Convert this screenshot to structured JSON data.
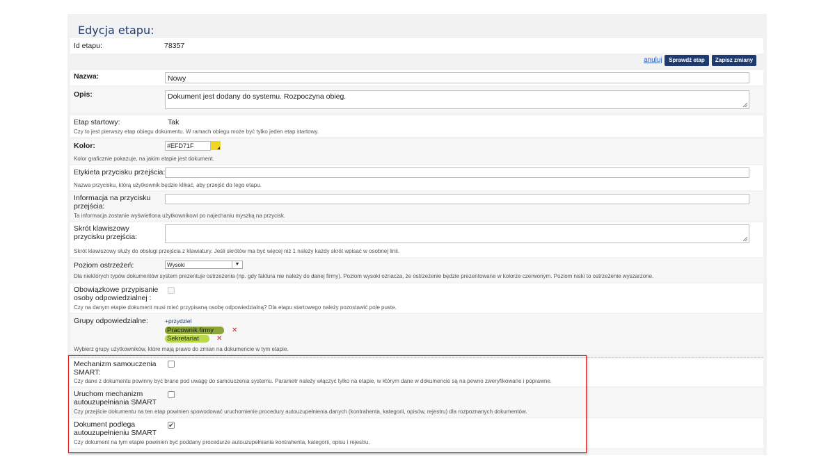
{
  "title": "Edycja etapu:",
  "id_label": "Id etapu:",
  "id_value": "78357",
  "actions": {
    "cancel": "anuluj",
    "check": "Sprawdź etap",
    "save": "Zapisz zmiany"
  },
  "name": {
    "label": "Nazwa:",
    "value": "Nowy"
  },
  "desc": {
    "label": "Opis:",
    "value": "Dokument jest dodany do systemu. Rozpoczyna obieg."
  },
  "start": {
    "label": "Etap startowy:",
    "value": "Tak",
    "hint": "Czy to jest pierwszy etap obiegu dokumentu. W ramach obiegu może być tylko jeden etap startowy."
  },
  "color": {
    "label": "Kolor:",
    "value": "#EFD71F",
    "hint": "Kolor graficznie pokazuje, na jakim etapie jest dokument."
  },
  "button_label": {
    "label": "Etykieta przycisku przejścia:",
    "hint": "Nazwa przycisku, którą użytkownik będzie klikać, aby przejść do tego etapu."
  },
  "button_info": {
    "label": "Informacja na przycisku przejścia:",
    "hint": "Ta informacja zostanie wyświetlona użytkownikowi po najechaniu myszką na przycisk."
  },
  "shortcut": {
    "label": "Skrót klawiszowy przycisku przejścia:",
    "hint": "Skrót klawiszowy służy do obsługi przejścia z klawiatury. Jeśli skrótów ma być więcej niż 1 należy każdy skrót wpisać w osobnej linii."
  },
  "warning": {
    "label": "Poziom ostrzeżeń:",
    "value": "Wysoki",
    "hint": "Dla niektórych typów dokumentów system prezentuje ostrzeżenia (np. gdy faktura nie należy do danej firmy). Poziom wysoki oznacza, że ostrzeżenie będzie prezentowane w kolorze czerwonym. Poziom niski to ostrzeżenie wyszarzone."
  },
  "mandatory": {
    "label": "Obowiązkowe przypisanie osoby odpowiedzialnej :",
    "hint": "Czy na danym etapie dokument musi mieć przypisaną osobę odpowiedzialną? Dla etapu startowego należy pozostawić pole puste."
  },
  "groups": {
    "label": "Grupy odpowiedzialne:",
    "add": "+przydziel",
    "items": [
      "Pracownik firmy",
      "Sekretariat"
    ],
    "hint": "Wybierz grupy użytkowników, które mają prawo do zmian na dokumencie w tym etapie.",
    "remove": "✕"
  },
  "smart_learn": {
    "label": "Mechanizm samouczenia SMART:",
    "checked": false,
    "hint": "Czy dane z dokumentu powinny być brane pod uwagę do samouczenia systemu. Parametr należy włączyć tylko na etapie, w którym dane w dokumencie są na pewno zweryfikowane i poprawne."
  },
  "smart_auto": {
    "label": "Uruchom mechanizm autouzupełniania SMART",
    "checked": false,
    "hint": "Czy przejście dokumentu na ten etap powinien spowodować uruchomienie procedury autouzupełnienia danych (kontrahenta, kategorii, opisów, rejestru) dla rozpoznanych dokumentów."
  },
  "smart_doc": {
    "label": "Dokument podlega autouzupełnieniu SMART",
    "checked": true,
    "checkmark": "✔",
    "hint": "Czy dokument na tym etapie powinien być poddany procedurze autouzupełniania kontrahenta, kategorii, opisu i rejestru."
  },
  "colors": {
    "accent": "#1f3a6e",
    "highlight": "#d61f1f",
    "stage": "#EFD71F",
    "tag1": "#8aa33a",
    "tag2": "#b9d94a"
  }
}
